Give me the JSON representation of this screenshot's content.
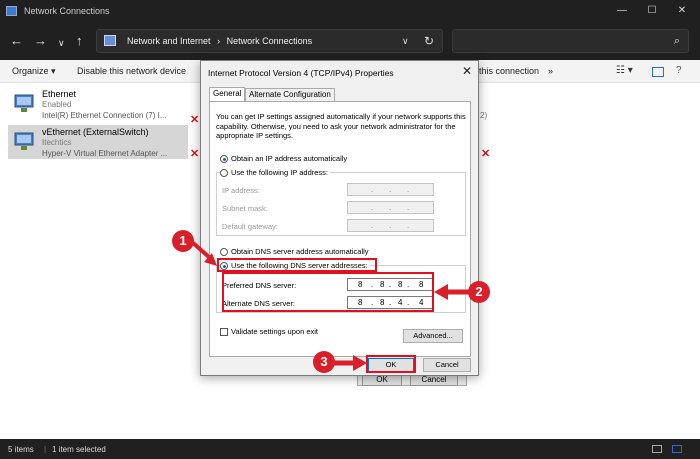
{
  "window": {
    "title": "Network Connections",
    "minimize": "—",
    "maximize": "☐",
    "close": "✕"
  },
  "nav": {
    "back": "←",
    "forward": "→",
    "down": "∨",
    "up": "↑",
    "breadcrumb_root": "Network and Internet",
    "breadcrumb_sep": "›",
    "breadcrumb_leaf": "Network Connections",
    "expand": "∨",
    "refresh": "↻",
    "search_icon": "⌕"
  },
  "commands": {
    "organize": "Organize ▾",
    "disable": "Disable this network device",
    "rename_tail": "this connection",
    "more": "»"
  },
  "connections": [
    {
      "name": "Ethernet",
      "status": "Enabled",
      "adapter": "Intel(R) Ethernet Connection (7) I..."
    },
    {
      "name": "vEthernet (ExternalSwitch)",
      "status": "Itechtics",
      "adapter": "Hyper-V Virtual Ethernet Adapter ..."
    }
  ],
  "background_dialog": {
    "ok": "OK",
    "cancel": "Cancel",
    "partial_number": "2)"
  },
  "statusbar": {
    "items": "5 items",
    "selected": "1 item selected"
  },
  "dialog": {
    "title": "Internet Protocol Version 4 (TCP/IPv4) Properties",
    "close": "✕",
    "tab_general": "General",
    "tab_alternate": "Alternate Configuration",
    "description": "You can get IP settings assigned automatically if your network supports this capability. Otherwise, you need to ask your network administrator for the appropriate IP settings.",
    "obtain_ip_auto": "Obtain an IP address automatically",
    "use_following_ip": "Use the following IP address:",
    "ip_address_label": "IP address:",
    "subnet_label": "Subnet mask:",
    "gateway_label": "Default gateway:",
    "obtain_dns_auto": "Obtain DNS server address automatically",
    "use_following_dns": "Use the following DNS server addresses:",
    "preferred_dns_label": "Preferred DNS server:",
    "alternate_dns_label": "Alternate DNS server:",
    "preferred_dns": [
      "8",
      "8",
      "8",
      "8"
    ],
    "alternate_dns": [
      "8",
      "8",
      "4",
      "4"
    ],
    "dot": ".",
    "validate_label": "Validate settings upon exit",
    "advanced": "Advanced...",
    "ok": "OK",
    "cancel": "Cancel"
  },
  "annotations": {
    "step1": "1",
    "step2": "2",
    "step3": "3",
    "highlight_color": "#e0101e"
  }
}
